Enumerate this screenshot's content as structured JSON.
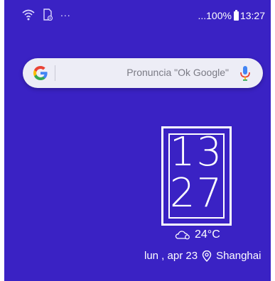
{
  "status_bar": {
    "left_icons": [
      "wifi-icon",
      "sd-card-icon"
    ],
    "left_overflow": "...",
    "right_overflow": "...",
    "battery_percent": "100%",
    "time": "13:27"
  },
  "search_widget": {
    "placeholder": "Pronuncia \"Ok Google\"",
    "icons": [
      "google-g-icon",
      "microphone-icon"
    ]
  },
  "clock_widget": {
    "hours": "13",
    "minutes": "27",
    "temperature": "24°C",
    "weather_icon": "cloud-sun-icon",
    "date": "lun , apr 23",
    "location_icon": "location-pin-icon",
    "location": "Shanghai"
  },
  "colors": {
    "wallpaper": "#3a22c4",
    "search_bar": "#ededf6",
    "mic": "#4285f4"
  }
}
